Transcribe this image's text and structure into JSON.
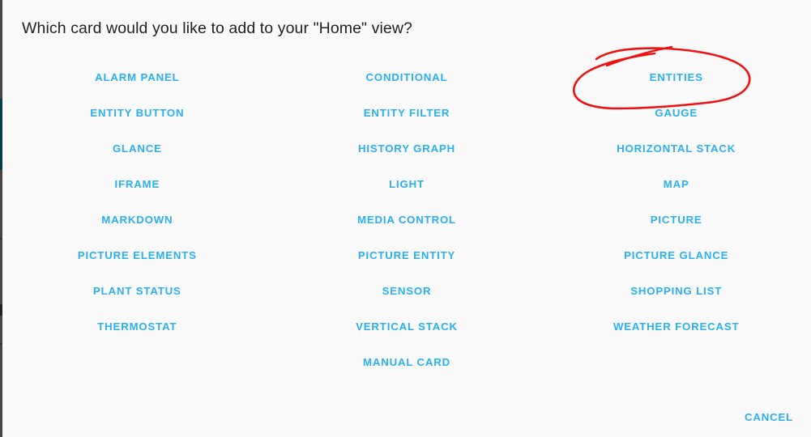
{
  "dialog": {
    "title": "Which card would you like to add to your \"Home\" view?",
    "cancel_label": "CANCEL"
  },
  "colors": {
    "background": "#fafafa",
    "link": "#2ab0f0",
    "title_text": "#212121",
    "annotation": "#ee1111",
    "edge_strip": "#4b4542",
    "edge_strip_accent": "#063b4c"
  },
  "columns": [
    {
      "name": "column-1",
      "options": [
        "ALARM PANEL",
        "ENTITY BUTTON",
        "GLANCE",
        "IFRAME",
        "MARKDOWN",
        "PICTURE ELEMENTS",
        "PLANT STATUS",
        "THERMOSTAT"
      ]
    },
    {
      "name": "column-2",
      "options": [
        "CONDITIONAL",
        "ENTITY FILTER",
        "HISTORY GRAPH",
        "LIGHT",
        "MEDIA CONTROL",
        "PICTURE ENTITY",
        "SENSOR",
        "VERTICAL STACK",
        "MANUAL CARD"
      ]
    },
    {
      "name": "column-3",
      "options": [
        "ENTITIES",
        "GAUGE",
        "HORIZONTAL STACK",
        "MAP",
        "PICTURE",
        "PICTURE GLANCE",
        "SHOPPING LIST",
        "WEATHER FORECAST"
      ]
    }
  ],
  "annotation": {
    "kind": "hand-drawn-ellipse",
    "target_label": "ENTITIES",
    "color": "#ee1111"
  }
}
